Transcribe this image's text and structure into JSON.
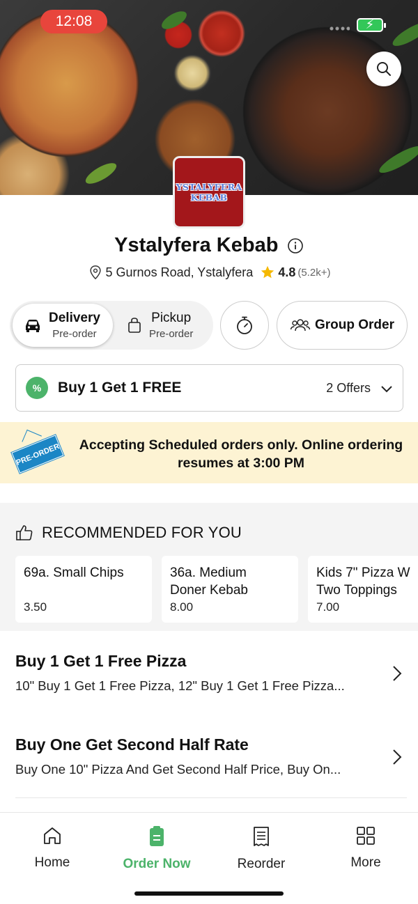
{
  "status_bar": {
    "time": "12:08",
    "battery_icon": "battery-charging-icon"
  },
  "header": {
    "search_icon": "search-icon"
  },
  "restaurant": {
    "logo_line1": "YSTALYFERA",
    "logo_line2": "KEBAB",
    "name": "Ystalyfera Kebab",
    "address": "5 Gurnos Road, Ystalyfera",
    "rating": "4.8",
    "rating_count": "(5.2k+)"
  },
  "order_mode": {
    "delivery_label": "Delivery",
    "delivery_sub": "Pre-order",
    "pickup_label": "Pickup",
    "pickup_sub": "Pre-order",
    "selected": "Delivery"
  },
  "group_order_label": "Group Order",
  "offers": {
    "title": "Buy 1 Get 1 FREE",
    "count_label": "2 Offers",
    "badge": "%"
  },
  "banner": {
    "sign_text": "PRE-ORDER",
    "message": "Accepting Scheduled orders only. Online ordering resumes at 3:00 PM"
  },
  "recommended": {
    "heading": "RECOMMENDED FOR YOU",
    "items": [
      {
        "name_line1": "69a. Small Chips",
        "name_line2": "",
        "price": "3.50"
      },
      {
        "name_line1": "36a. Medium",
        "name_line2": "Doner Kebab",
        "price": "8.00"
      },
      {
        "name_line1": "Kids 7\" Pizza W",
        "name_line2": "Two Toppings",
        "price": "7.00"
      }
    ]
  },
  "promotions": [
    {
      "title": "Buy 1 Get 1 Free Pizza",
      "description": "10\" Buy 1 Get 1 Free Pizza, 12\" Buy 1 Get 1 Free Pizza..."
    },
    {
      "title": "Buy One Get Second Half Rate",
      "description": "Buy One 10\" Pizza And Get Second Half Price, Buy On..."
    }
  ],
  "bottom_nav": {
    "items": [
      {
        "label": "Home",
        "icon": "home-icon"
      },
      {
        "label": "Order Now",
        "icon": "order-icon"
      },
      {
        "label": "Reorder",
        "icon": "receipt-icon"
      },
      {
        "label": "More",
        "icon": "grid-icon"
      }
    ],
    "active": "Order Now",
    "accent": "#4cb36a"
  }
}
